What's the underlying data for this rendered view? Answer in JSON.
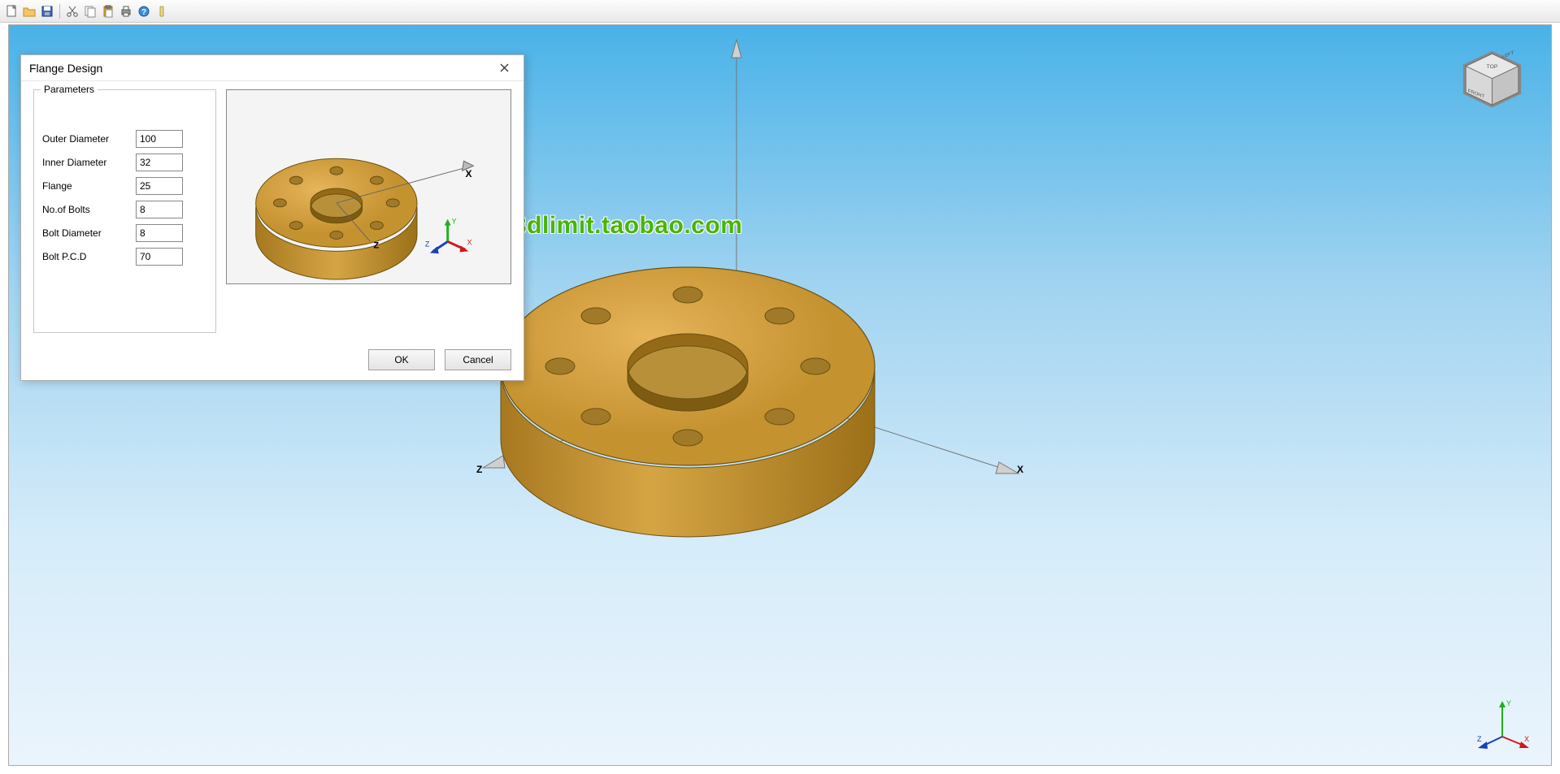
{
  "dialog": {
    "title": "Flange Design",
    "group_title": "Parameters",
    "params": {
      "outer_diameter_label": "Outer Diameter",
      "outer_diameter_value": "100",
      "inner_diameter_label": "Inner Diameter",
      "inner_diameter_value": "32",
      "flange_label": "Flange",
      "flange_value": "25",
      "no_bolts_label": "No.of Bolts",
      "no_bolts_value": "8",
      "bolt_diameter_label": "Bolt Diameter",
      "bolt_diameter_value": "8",
      "bolt_pcd_label": "Bolt P.C.D",
      "bolt_pcd_value": "70"
    },
    "ok_label": "OK",
    "cancel_label": "Cancel"
  },
  "watermark": "3dlimit.taobao.com",
  "axes": {
    "x": "X",
    "y": "Y",
    "z": "Z"
  },
  "viewcube": {
    "top": "TOP",
    "front": "FRONT",
    "left": "LEFT"
  },
  "toolbar": {
    "new": "new-document-icon",
    "open": "open-folder-icon",
    "save": "save-icon",
    "cut": "cut-icon",
    "copy": "copy-icon",
    "paste": "paste-icon",
    "print": "print-icon",
    "help": "help-icon",
    "refresh": "refresh-icon"
  }
}
